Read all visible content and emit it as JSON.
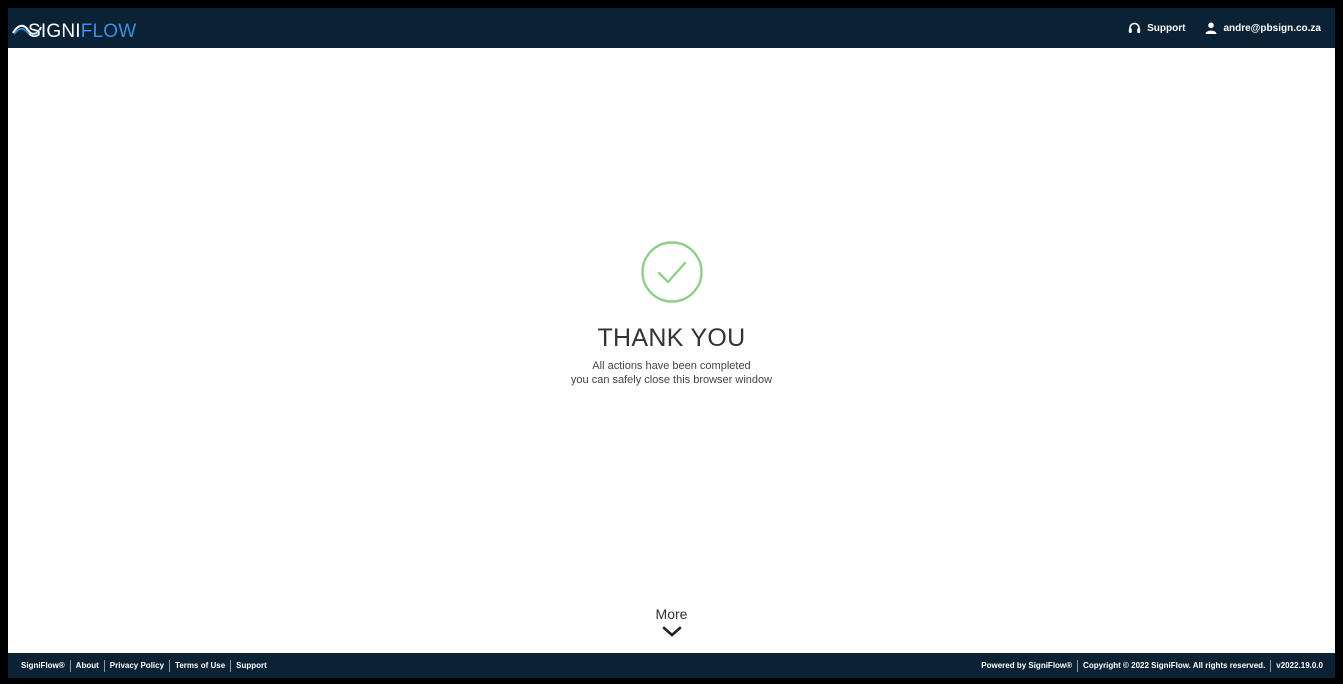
{
  "header": {
    "logo_text_main": "SIGNI",
    "logo_text_accent": "FLOW",
    "support_label": "Support",
    "user_email": "andre@pbsign.co.za",
    "colors": {
      "bar": "#0b2134",
      "logo_accent": "#3f8fe0"
    }
  },
  "main": {
    "icon": "check-circle-icon",
    "icon_color": "#8fd088",
    "title": "THANK YOU",
    "message_line1": "All actions have been completed",
    "message_line2": "you can safely close this browser window",
    "more_label": "More"
  },
  "footer": {
    "left_links": [
      "SigniFlow®",
      "About",
      "Privacy Policy",
      "Terms of Use",
      "Support"
    ],
    "powered_by": "Powered by SigniFlow®",
    "copyright": "Copyright © 2022 SigniFlow. All rights reserved.",
    "version": "v2022.19.0.0"
  }
}
